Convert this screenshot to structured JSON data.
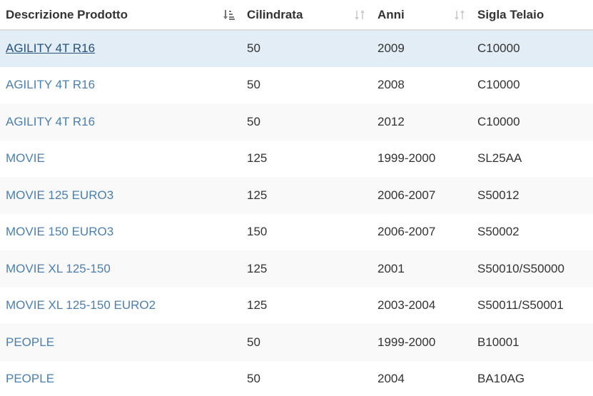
{
  "columns": [
    {
      "label": "Descrizione Prodotto",
      "sort": "active-desc"
    },
    {
      "label": "Cilindrata",
      "sort": "none"
    },
    {
      "label": "Anni",
      "sort": "none"
    },
    {
      "label": "Sigla Telaio",
      "sort": "none"
    }
  ],
  "rows": [
    {
      "descrizione": "AGILITY 4T R16",
      "cilindrata": "50",
      "anni": "2009",
      "sigla": "C10000"
    },
    {
      "descrizione": "AGILITY 4T R16",
      "cilindrata": "50",
      "anni": "2008",
      "sigla": "C10000"
    },
    {
      "descrizione": "AGILITY 4T R16",
      "cilindrata": "50",
      "anni": "2012",
      "sigla": "C10000"
    },
    {
      "descrizione": "MOVIE",
      "cilindrata": "125",
      "anni": "1999-2000",
      "sigla": "SL25AA"
    },
    {
      "descrizione": "MOVIE 125 EURO3",
      "cilindrata": "125",
      "anni": "2006-2007",
      "sigla": "S50012"
    },
    {
      "descrizione": "MOVIE 150 EURO3",
      "cilindrata": "150",
      "anni": "2006-2007",
      "sigla": "S50002"
    },
    {
      "descrizione": "MOVIE XL 125-150",
      "cilindrata": "125",
      "anni": "2001",
      "sigla": "S50010/S50000"
    },
    {
      "descrizione": "MOVIE XL 125-150 EURO2",
      "cilindrata": "125",
      "anni": "2003-2004",
      "sigla": "S50011/S50001"
    },
    {
      "descrizione": "PEOPLE",
      "cilindrata": "50",
      "anni": "1999-2000",
      "sigla": "B10001"
    },
    {
      "descrizione": "PEOPLE",
      "cilindrata": "50",
      "anni": "2004",
      "sigla": "BA10AG"
    }
  ],
  "selected_row": 0,
  "colors": {
    "link": "#4a7fb0",
    "link_selected": "#23527c",
    "selected_bg": "#e3edf5",
    "sort_active": "#777777",
    "sort_inactive": "#cccccc"
  },
  "icons": {
    "sort_active": "sort-amount-desc-icon",
    "sort_inactive": "sort-both-icon"
  }
}
